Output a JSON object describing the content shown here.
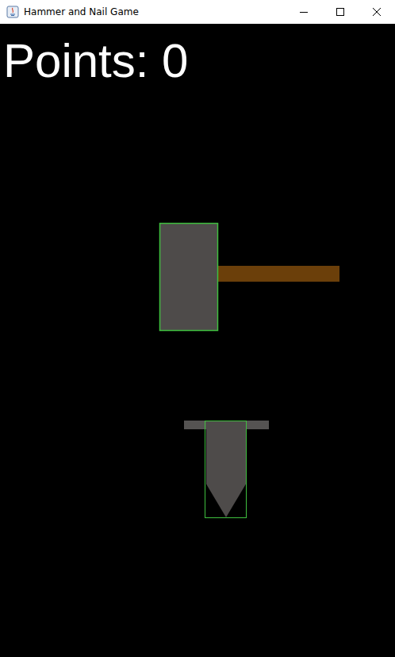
{
  "window": {
    "title": "Hammer and Nail Game"
  },
  "score": {
    "label": "Points: 0"
  },
  "hitboxes_visible": true
}
